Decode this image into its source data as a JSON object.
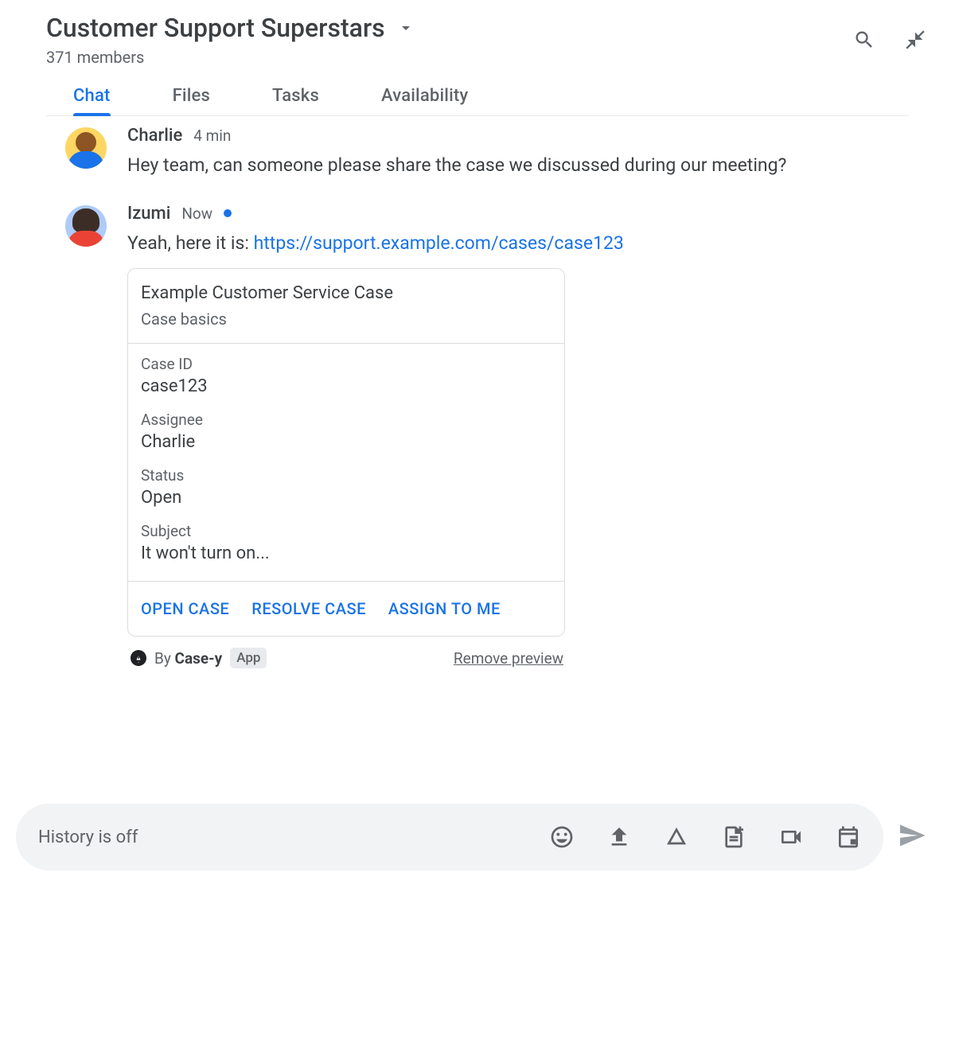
{
  "header": {
    "title": "Customer Support Superstars",
    "members": "371 members"
  },
  "tabs": [
    {
      "label": "Chat",
      "active": true
    },
    {
      "label": "Files",
      "active": false
    },
    {
      "label": "Tasks",
      "active": false
    },
    {
      "label": "Availability",
      "active": false
    }
  ],
  "messages": [
    {
      "author": "Charlie",
      "time": "4 min",
      "unread": false,
      "text": "Hey team, can someone please share the case we discussed during our meeting?"
    },
    {
      "author": "Izumi",
      "time": "Now",
      "unread": true,
      "text_prefix": "Yeah, here it is: ",
      "link": "https://support.example.com/cases/case123"
    }
  ],
  "card": {
    "title": "Example Customer Service Case",
    "subtitle": "Case basics",
    "fields": [
      {
        "label": "Case ID",
        "value": "case123"
      },
      {
        "label": "Assignee",
        "value": "Charlie"
      },
      {
        "label": "Status",
        "value": "Open"
      },
      {
        "label": "Subject",
        "value": "It won't turn on..."
      }
    ],
    "actions": [
      "OPEN CASE",
      "RESOLVE CASE",
      "ASSIGN TO ME"
    ],
    "source_prefix": "By ",
    "source_name": "Case-y",
    "app_badge": "App",
    "remove_link": "Remove preview"
  },
  "composer": {
    "placeholder": "History is off"
  }
}
